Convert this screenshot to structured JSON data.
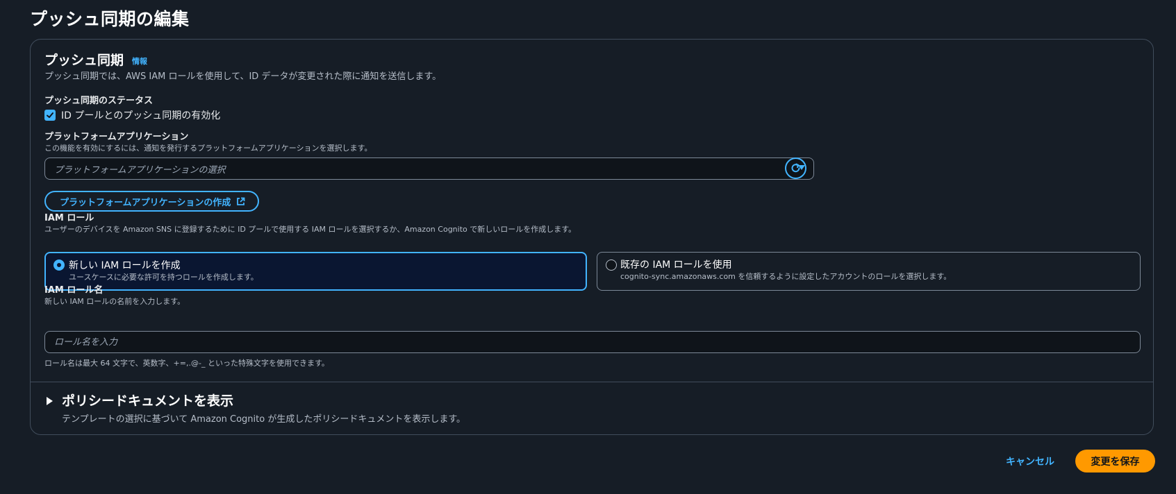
{
  "page": {
    "title": "プッシュ同期の編集"
  },
  "push_sync": {
    "title": "プッシュ同期",
    "info_link": "情報",
    "description": "プッシュ同期では、AWS IAM ロールを使用して、ID データが変更された際に通知を送信します。",
    "status_label": "プッシュ同期のステータス",
    "enable_checkbox_label": "ID プールとのプッシュ同期の有効化",
    "enable_checked": true
  },
  "platform_app": {
    "label": "プラットフォームアプリケーション",
    "description": "この機能を有効にするには、通知を発行するプラットフォームアプリケーションを選択します。",
    "select_placeholder": "プラットフォームアプリケーションの選択",
    "create_button_label": "プラットフォームアプリケーションの作成"
  },
  "iam_role": {
    "label": "IAM ロール",
    "description": "ユーザーのデバイスを Amazon SNS に登録するために ID プールで使用する IAM ロールを選択するか、Amazon Cognito で新しいロールを作成します。",
    "options": [
      {
        "title": "新しい IAM ロールを作成",
        "description": "ユースケースに必要な許可を持つロールを作成します。",
        "selected": true
      },
      {
        "title": "既存の IAM ロールを使用",
        "description": "cognito-sync.amazonaws.com を信頼するように設定したアカウントのロールを選択します。",
        "selected": false
      }
    ]
  },
  "role_name": {
    "label": "IAM ロール名",
    "description": "新しい IAM ロールの名前を入力します。",
    "placeholder": "ロール名を入力",
    "value": "",
    "constraint": "ロール名は最大 64 文字で、英数字、+=,.@-_ といった特殊文字を使用できます。"
  },
  "policy_doc": {
    "title": "ポリシードキュメントを表示",
    "description": "テンプレートの選択に基づいて Amazon Cognito が生成したポリシードキュメントを表示します。",
    "expanded": false
  },
  "actions": {
    "cancel_label": "キャンセル",
    "save_label": "変更を保存"
  },
  "colors": {
    "background": "#161d26",
    "accent": "#42b4ff",
    "primary_button": "#ff9900"
  }
}
